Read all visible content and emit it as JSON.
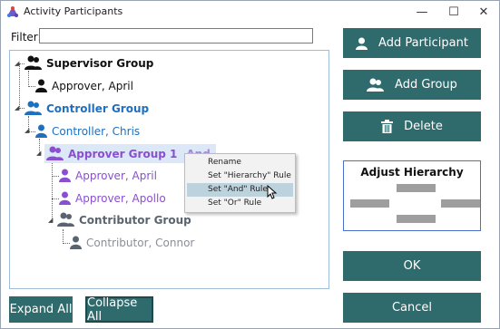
{
  "window": {
    "title": "Activity Participants",
    "controls": {
      "minimize": "—",
      "maximize": "☐",
      "close": "✕"
    }
  },
  "filter": {
    "label": "Filter:",
    "value": ""
  },
  "tree": {
    "nodes": [
      {
        "label": "Supervisor Group"
      },
      {
        "label": "Approver, April"
      },
      {
        "label": "Controller Group"
      },
      {
        "label": "Controller, Chris"
      },
      {
        "label": "Approver Group 1",
        "tag": "And"
      },
      {
        "label": "Approver, April"
      },
      {
        "label": "Approver, Apollo"
      },
      {
        "label": "Contributor Group"
      },
      {
        "label": "Contributor, Connor"
      }
    ]
  },
  "context_menu": {
    "items": [
      "Rename",
      "Set \"Hierarchy\" Rule",
      "Set \"And\" Rule",
      "Set \"Or\" Rule"
    ],
    "highlighted_index": 2
  },
  "buttons": {
    "add_participant": "Add Participant",
    "add_group": "Add Group",
    "delete": "Delete",
    "ok": "OK",
    "cancel": "Cancel",
    "expand_all": "Expand All",
    "collapse_all": "Collapse All"
  },
  "hierarchy": {
    "title": "Adjust Hierarchy"
  },
  "colors": {
    "button_bg": "#2f6b6d",
    "group_blue": "#1f6fbf",
    "group_purple": "#8a4fd0",
    "group_gray": "#5a6470",
    "hierarchy_border": "#4b6fd0",
    "menu_highlight": "#bcd3dd"
  }
}
